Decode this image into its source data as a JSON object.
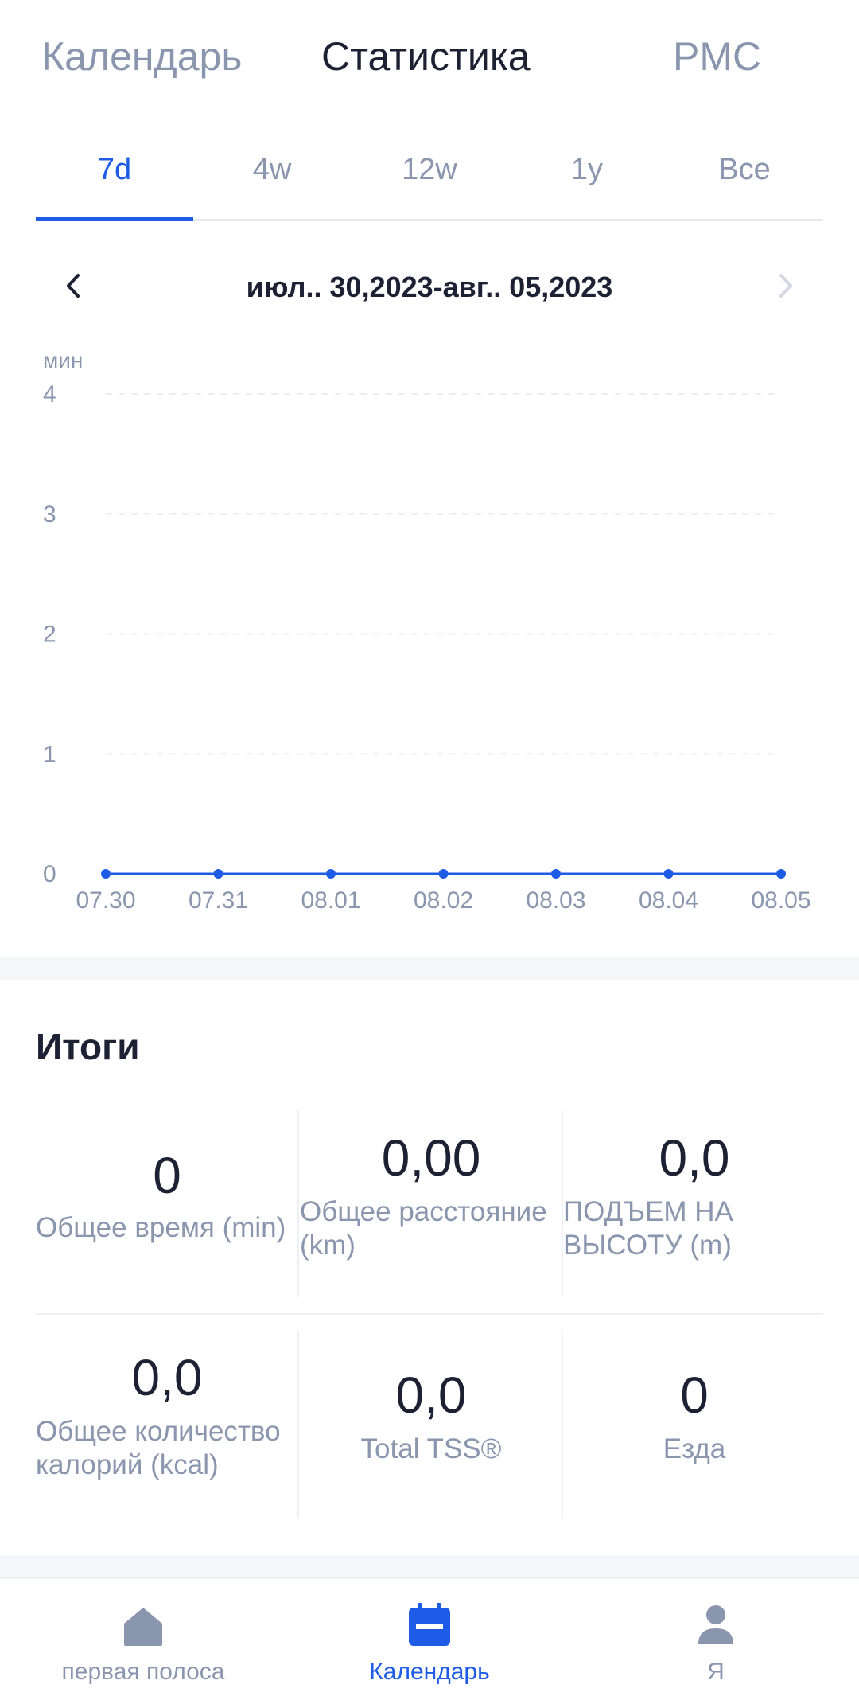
{
  "top_tabs": [
    {
      "label": "Календарь",
      "active": false
    },
    {
      "label": "Статистика",
      "active": true
    },
    {
      "label": "PMC",
      "active": false
    }
  ],
  "range_tabs": [
    {
      "label": "7d",
      "active": true
    },
    {
      "label": "4w",
      "active": false
    },
    {
      "label": "12w",
      "active": false
    },
    {
      "label": "1y",
      "active": false
    },
    {
      "label": "Все",
      "active": false
    }
  ],
  "date_nav": {
    "range": "июл.. 30,2023-авг.. 05,2023",
    "prev_icon": "chevron-left-icon",
    "next_icon": "chevron-right-icon"
  },
  "chart_data": {
    "type": "line",
    "ylabel": "мин",
    "ylim": [
      0,
      4
    ],
    "yticks": [
      "0",
      "1",
      "2",
      "3",
      "4"
    ],
    "x": [
      "07.30",
      "07.31",
      "08.01",
      "08.02",
      "08.03",
      "08.04",
      "08.05"
    ],
    "series": [
      {
        "values": [
          0,
          0,
          0,
          0,
          0,
          0,
          0
        ],
        "color": "#1e5be6"
      }
    ],
    "grid": true
  },
  "summary": {
    "title": "Итоги",
    "stats": [
      {
        "value": "0",
        "label": "Общее время (min)"
      },
      {
        "value": "0,00",
        "label": "Общее расстояние (km)"
      },
      {
        "value": "0,0",
        "label": "ПОДЪЕМ НА ВЫСОТУ (m)"
      },
      {
        "value": "0,0",
        "label": "Общее количество калорий (kcal)"
      },
      {
        "value": "0,0",
        "label": "Total TSS®"
      },
      {
        "value": "0",
        "label": "Езда"
      }
    ]
  },
  "bottom_nav": [
    {
      "label": "первая полоса",
      "icon": "home-icon",
      "active": false
    },
    {
      "label": "Календарь",
      "icon": "calendar-icon",
      "active": true
    },
    {
      "label": "Я",
      "icon": "person-icon",
      "active": false
    }
  ],
  "colors": {
    "accent": "#1e5be6",
    "muted": "#8a96ae",
    "text": "#1c2233"
  }
}
